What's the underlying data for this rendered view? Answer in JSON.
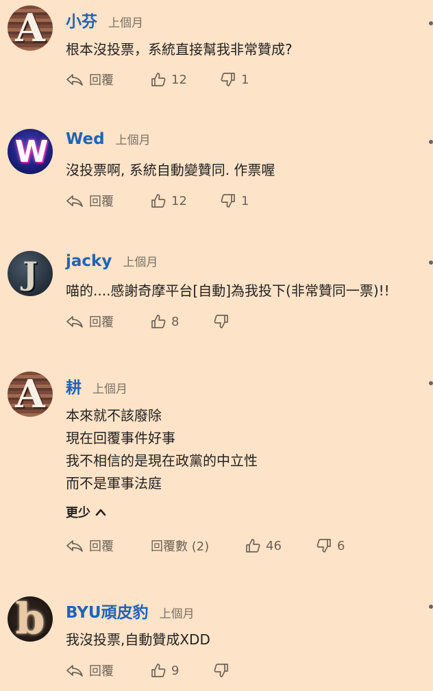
{
  "labels": {
    "reply": "回覆",
    "show_less": "更少"
  },
  "comments": [
    {
      "name": "小芬",
      "time": "上個月",
      "avatar_letter": "A",
      "lines": [
        "根本沒投票，系統直接幫我非常贊成?"
      ],
      "likes": "12",
      "dislikes": "1"
    },
    {
      "name": "Wed",
      "time": "上個月",
      "avatar_letter": "W",
      "lines": [
        "沒投票啊, 系統自動變贊同. 作票喔"
      ],
      "likes": "12",
      "dislikes": "1"
    },
    {
      "name": "jacky",
      "time": "上個月",
      "avatar_letter": "J",
      "lines": [
        "喵的....感謝奇摩平台[自動]為我投下(非常贊同一票)!!"
      ],
      "likes": "8",
      "dislikes": ""
    },
    {
      "name": "耕",
      "time": "上個月",
      "avatar_letter": "A",
      "lines": [
        "本來就不該廢除",
        "現在回覆事件好事",
        "我不相信的是現在政黨的中立性",
        "而不是軍事法庭"
      ],
      "replies_label": "回覆數 (2)",
      "likes": "46",
      "dislikes": "6"
    },
    {
      "name": "BYU頑皮豹",
      "time": "上個月",
      "avatar_letter": "b",
      "lines": [
        "我沒投票,自動贊成XDD"
      ],
      "likes": "9",
      "dislikes": ""
    }
  ]
}
